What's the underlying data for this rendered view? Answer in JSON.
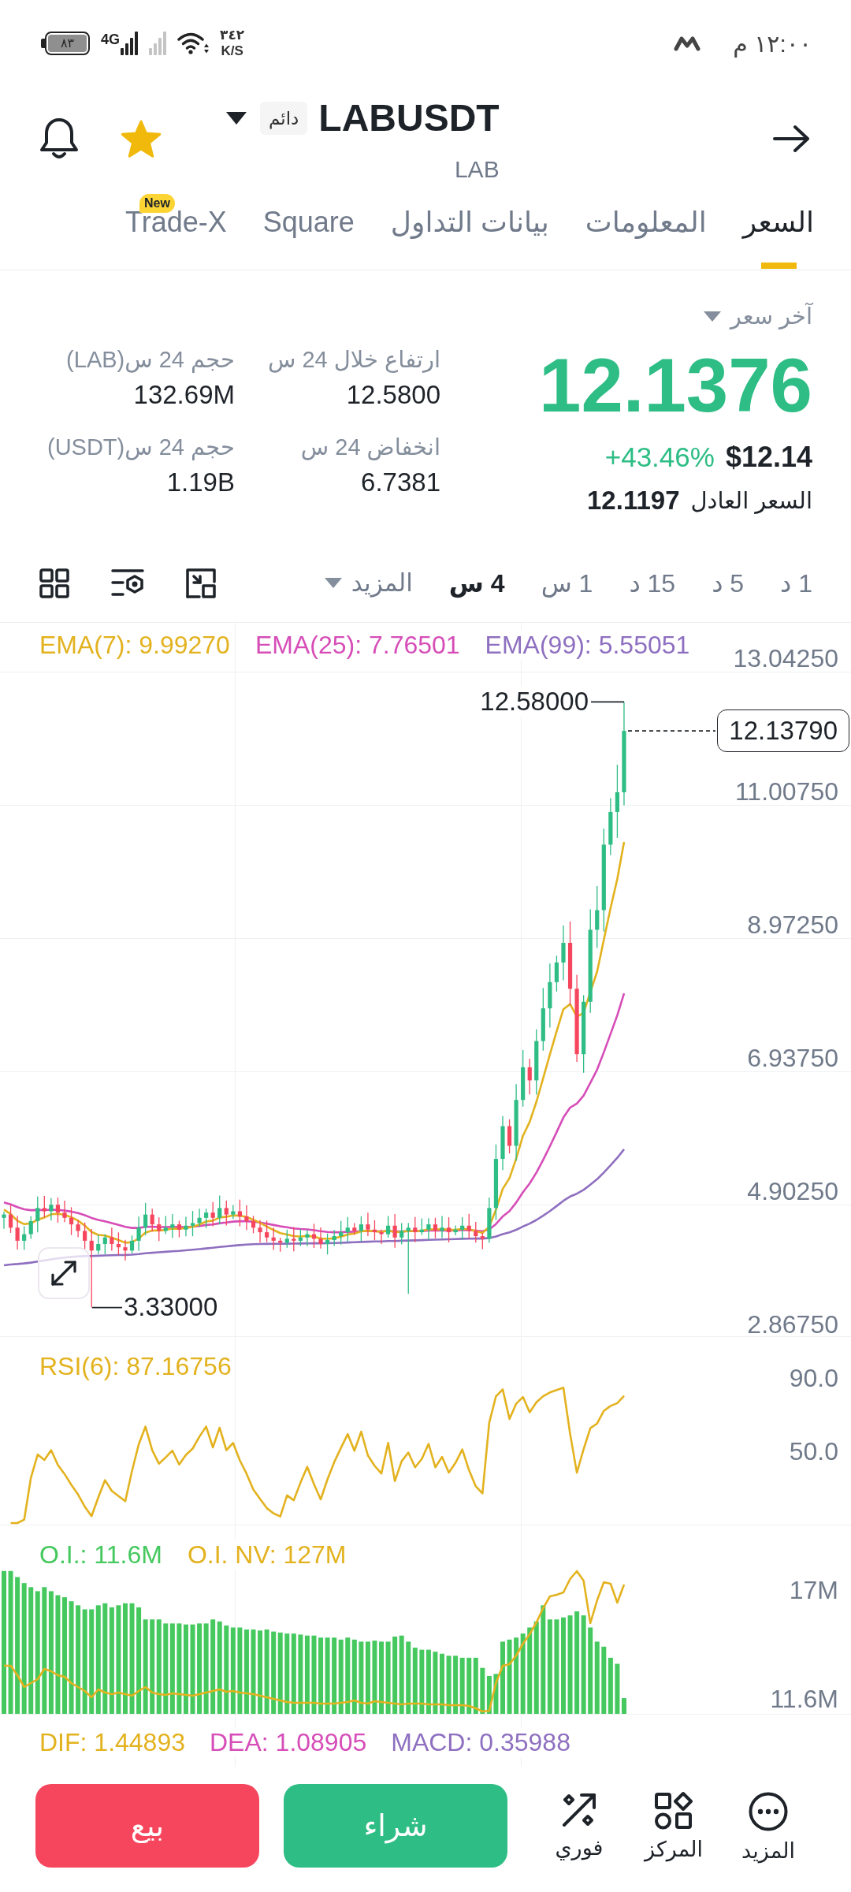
{
  "status_bar": {
    "time": "١٢:٠٠ م",
    "battery": "٨٣",
    "network": "4G",
    "speed": "٣٤٢",
    "speed_unit": "K/S"
  },
  "header": {
    "symbol": "LABUSDT",
    "badge": "دائم",
    "subtitle": "LAB",
    "favorite": true
  },
  "tabs": [
    {
      "label": "السعر",
      "selected": true
    },
    {
      "label": "المعلومات",
      "selected": false
    },
    {
      "label": "بيانات التداول",
      "selected": false
    },
    {
      "label": "Square",
      "selected": false
    },
    {
      "label": "Trade-X",
      "selected": false,
      "badge": "New"
    }
  ],
  "price": {
    "label": "آخر سعر",
    "last": "12.1376",
    "usd": "$12.14",
    "change": "+43.46%",
    "fair_label": "السعر العادل",
    "fair_value": "12.1197"
  },
  "stats": [
    {
      "label": "ارتفاع خلال 24 س",
      "value": "12.5800"
    },
    {
      "label": "حجم 24 س(LAB)",
      "value": "132.69M"
    },
    {
      "label": "انخفاض 24 س",
      "value": "6.7381"
    },
    {
      "label": "حجم 24 س(USDT)",
      "value": "1.19B"
    }
  ],
  "intervals": [
    {
      "label": "1 د",
      "selected": false
    },
    {
      "label": "5 د",
      "selected": false
    },
    {
      "label": "15 د",
      "selected": false
    },
    {
      "label": "1 س",
      "selected": false
    },
    {
      "label": "4 س",
      "selected": true
    }
  ],
  "more_intervals": "المزيد",
  "chart": {
    "legend": [
      {
        "label": "EMA(99): 5.55051",
        "color": "#8e6fc0"
      },
      {
        "label": "EMA(25): 7.76501",
        "color": "#d64db8"
      },
      {
        "label": "EMA(7): 9.99270",
        "color": "#e3b21f"
      }
    ],
    "y_labels": [
      "13.04250",
      "11.00750",
      "8.97250",
      "6.93750",
      "4.90250",
      "2.86750"
    ],
    "high_label": "12.58000",
    "low_label": "3.33000",
    "last_price": "12.13790"
  },
  "rsi": {
    "legend": "RSI(6): 87.16756",
    "y_labels": [
      "90.0",
      "50.0"
    ]
  },
  "open_interest": {
    "legend": [
      {
        "label": "O.I. NV: 127M",
        "color": "#e3b21f"
      },
      {
        "label": "O.I.: 11.6M",
        "color": "#45c95f"
      }
    ],
    "y_labels": [
      "17M",
      "11.6M"
    ]
  },
  "macd": {
    "legend": [
      {
        "label": "MACD: 0.35988",
        "color": "#8e6fc0"
      },
      {
        "label": "DEA: 1.08905",
        "color": "#d64db8"
      },
      {
        "label": "DIF: 1.44893",
        "color": "#e3b21f"
      }
    ]
  },
  "bottom_nav": [
    "المزيد",
    "المركز",
    "فوري"
  ],
  "actions": [
    {
      "label": "شراء",
      "kind": "buy"
    },
    {
      "label": "بيع",
      "kind": "sell"
    }
  ]
}
